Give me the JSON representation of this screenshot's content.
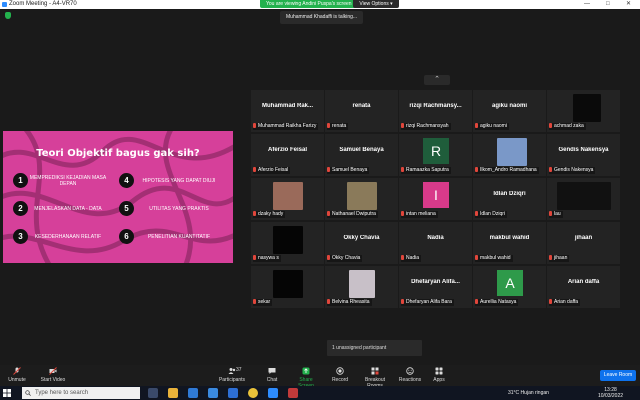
{
  "window": {
    "title": "Zoom Meeting - A4-VR70",
    "minimize": "—",
    "maximize": "□",
    "close": "✕"
  },
  "banner": {
    "share_text": "You are viewing Andini Puspa's screen",
    "view_options": "View Options ▾"
  },
  "talking": "Muhammad Khadaffi is talking...",
  "slide": {
    "title": "Teori Objektif bagus gak sih?",
    "items": [
      {
        "num": "1",
        "text": "MEMPREDIKSI KEJADIAN MASA DEPAN"
      },
      {
        "num": "2",
        "text": "MENJELASKAN DATA - DATA"
      },
      {
        "num": "3",
        "text": "KESEDERHANAAN RELATIF"
      },
      {
        "num": "4",
        "text": "HIPOTESIS YANG DAPAT DIUJI"
      },
      {
        "num": "5",
        "text": "UTILITAS YANG PRAKTIS"
      },
      {
        "num": "6",
        "text": "PENELITIAN KUANTITATIF"
      }
    ]
  },
  "chevron": "⌃",
  "participants": [
    {
      "big": "Muhammad Rak...",
      "label": "Muhammad Raikha Farizy"
    },
    {
      "big": "renata",
      "label": "renata"
    },
    {
      "big": "rizqi Rachmansy...",
      "label": "rizqi Rachmansyah"
    },
    {
      "big": "agiku naomi",
      "label": "agiku naomi"
    },
    {
      "big": "",
      "label": "achmad zaka",
      "video": "#0a0a0a"
    },
    {
      "big": "Aferzio Feisal",
      "label": "Aferzio Feisal"
    },
    {
      "big": "Samuel Benaya",
      "label": "Samuel Benaya"
    },
    {
      "big": "",
      "label": "Ramaazka Saputra",
      "letter": "R",
      "letter_color": "#1f5d3b"
    },
    {
      "big": "",
      "label": "Ilkom_Andro Ramadhana",
      "video": "#7a98c8"
    },
    {
      "big": "Gendis Nakensya",
      "label": "Gendis Nakensya"
    },
    {
      "big": "",
      "label": "dzaky hady",
      "video": "#9a6a5a"
    },
    {
      "big": "",
      "label": "Nathanael Dwiputra",
      "video": "#8a7a5a"
    },
    {
      "big": "",
      "label": "intan meliana",
      "letter": "I",
      "letter_color": "#d83a8a"
    },
    {
      "big": "Idlan Dziqri",
      "label": "Idlan Dziqri"
    },
    {
      "big": "",
      "label": "lau",
      "video": "#111111"
    },
    {
      "big": "",
      "label": "nasywa s",
      "video": "#050505"
    },
    {
      "big": "Okky Chavia",
      "label": "Okky Chavia"
    },
    {
      "big": "Nadia",
      "label": "Nadia"
    },
    {
      "big": "makbul wahid",
      "label": "makbul wahid"
    },
    {
      "big": "jihaan",
      "label": "jihaan"
    },
    {
      "big": "",
      "label": "sekar",
      "video": "#050505"
    },
    {
      "big": "",
      "label": "Belvina Rheasita",
      "video": "#c8c0c8"
    },
    {
      "big": "Dhefaryan Alifa...",
      "label": "Dhefaryan Alifa Bara"
    },
    {
      "big": "",
      "label": "Aurellia Natasya",
      "letter": "A",
      "letter_color": "#2e9a4a"
    },
    {
      "big": "Arian daffa",
      "label": "Arian daffa"
    }
  ],
  "unassigned": "1 unassigned participant",
  "toolbar": {
    "unmute": "Unmute",
    "start_video": "Start Video",
    "participants": "Participants",
    "participants_count": "37",
    "chat": "Chat",
    "share_screen": "Share Screen",
    "record": "Record",
    "breakout_rooms": "Breakout Rooms",
    "reactions": "Reactions",
    "apps": "Apps",
    "leave": "Leave Room"
  },
  "taskbar": {
    "search_placeholder": "Type here to search",
    "weather": "31°C  Hujan ringan",
    "time": "13:28",
    "date": "10/03/2022"
  },
  "colors": {
    "accent": "#0e72ed",
    "share_green": "#23b14d",
    "slide_pink": "#d6409a"
  }
}
